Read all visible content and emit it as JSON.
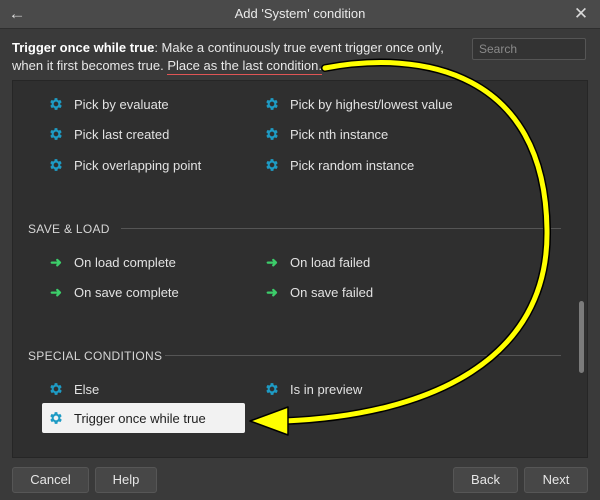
{
  "window": {
    "title": "Add 'System' condition",
    "back_glyph": "←",
    "close_glyph": "✕"
  },
  "description": {
    "bold": "Trigger once while true",
    "text": ": Make a continuously true event trigger once only, when it first becomes true. ",
    "highlight": "Place as the last condition."
  },
  "search": {
    "placeholder": "Search"
  },
  "pick_items": [
    "Pick by evaluate",
    "Pick by highest/lowest value",
    "Pick last created",
    "Pick nth instance",
    "Pick overlapping point",
    "Pick random instance"
  ],
  "save_load": {
    "heading": "SAVE & LOAD",
    "items": [
      "On load complete",
      "On load failed",
      "On save complete",
      "On save failed"
    ]
  },
  "special": {
    "heading": "SPECIAL CONDITIONS",
    "items": [
      "Else",
      "Is in preview",
      "Trigger once while true"
    ]
  },
  "buttons": {
    "cancel": "Cancel",
    "help": "Help",
    "back": "Back",
    "next": "Next"
  },
  "colors": {
    "gear": "#1e9bc4",
    "trigger_arrow": "#3ccd6a",
    "annotation": "#ffff00",
    "underline": "#e05555"
  }
}
